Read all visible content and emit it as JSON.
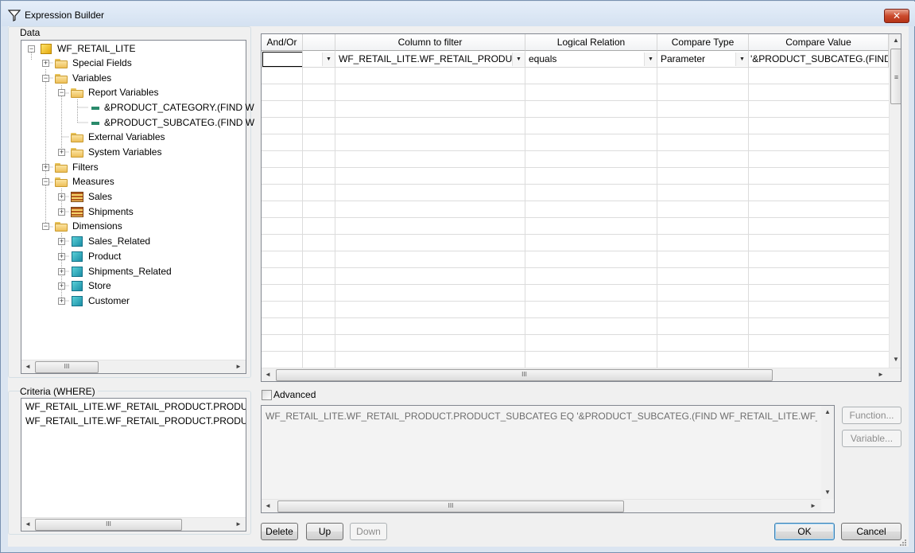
{
  "window": {
    "title": "Expression Builder",
    "close_glyph": "✕"
  },
  "data_panel": {
    "label": "Data",
    "tree": {
      "root": "WF_RETAIL_LITE",
      "special_fields": "Special Fields",
      "variables": "Variables",
      "report_variables": "Report Variables",
      "product_category_var": "&PRODUCT_CATEGORY.(FIND W",
      "product_subcateg_var": "&PRODUCT_SUBCATEG.(FIND W",
      "external_variables": "External Variables",
      "system_variables": "System Variables",
      "filters": "Filters",
      "measures": "Measures",
      "sales": "Sales",
      "shipments": "Shipments",
      "dimensions": "Dimensions",
      "sales_related": "Sales_Related",
      "product": "Product",
      "shipments_related": "Shipments_Related",
      "store": "Store",
      "customer": "Customer"
    },
    "scroll_grip": "III"
  },
  "grid": {
    "headers": {
      "and_or": "And/Or",
      "column_to_filter": "Column to filter",
      "logical_relation": "Logical Relation",
      "compare_type": "Compare Type",
      "compare_value": "Compare Value"
    },
    "row1": {
      "and_or": "",
      "column": "WF_RETAIL_LITE.WF_RETAIL_PRODUCT",
      "relation": "equals",
      "compare_type": "Parameter",
      "compare_value": "'&PRODUCT_SUBCATEG.(FIND W"
    },
    "scroll_grip": "III",
    "vscroll_grip": "≡"
  },
  "criteria": {
    "label": "Criteria (WHERE)",
    "items": [
      "WF_RETAIL_LITE.WF_RETAIL_PRODUCT.PRODUCT_C",
      "WF_RETAIL_LITE.WF_RETAIL_PRODUCT.PRODUCT_S"
    ],
    "scroll_grip": "III"
  },
  "expression": {
    "advanced_label": "Advanced",
    "text": "WF_RETAIL_LITE.WF_RETAIL_PRODUCT.PRODUCT_SUBCATEG EQ '&PRODUCT_SUBCATEG.(FIND WF_RETAIL_LITE.WF_RETAIL_PRODUC",
    "scroll_grip": "III"
  },
  "buttons": {
    "function": "Function...",
    "variable": "Variable...",
    "delete": "Delete",
    "up": "Up",
    "down": "Down",
    "ok": "OK",
    "cancel": "Cancel"
  },
  "icons": {
    "app": "filter-funnel-icon",
    "dropdown": "▼",
    "scroll_left": "◄",
    "scroll_right": "►",
    "scroll_up": "▲",
    "scroll_down": "▼",
    "expand_plus": "+",
    "collapse_minus": "−"
  }
}
